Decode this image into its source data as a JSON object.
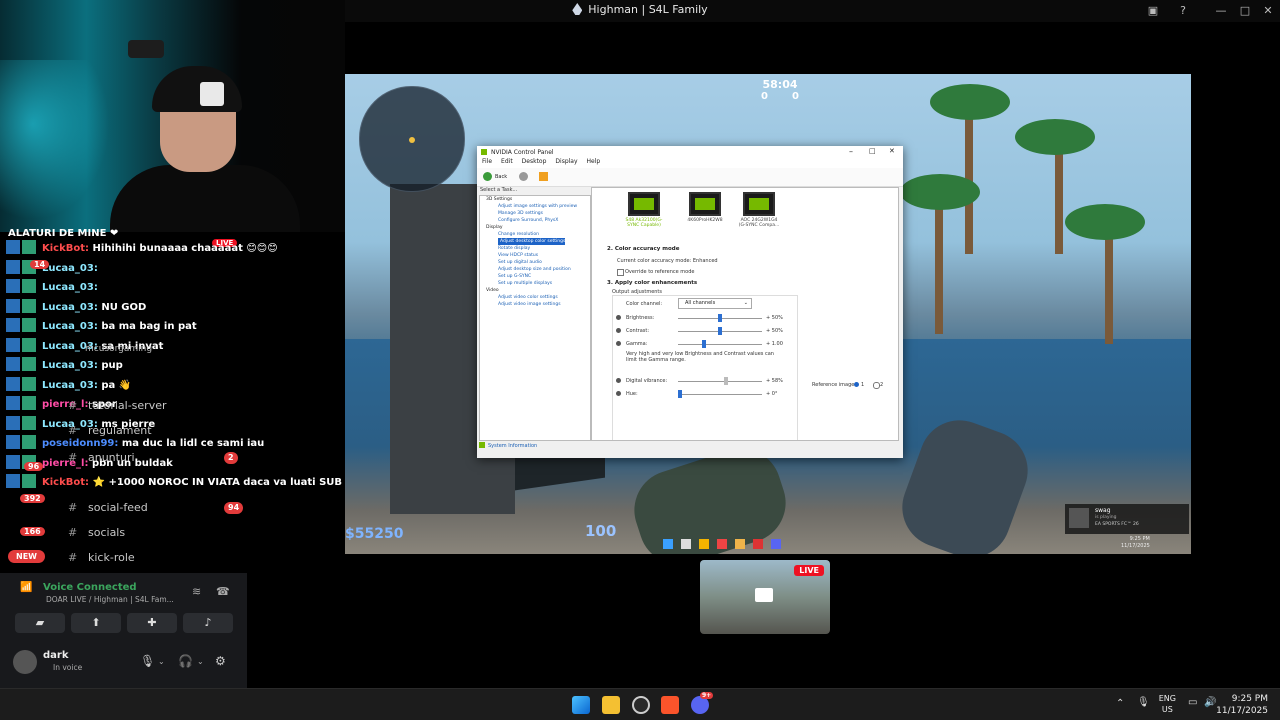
{
  "window": {
    "title": "Highman | S4L Family"
  },
  "chat": {
    "header": "ALATURI DE MINE ❤",
    "live_badge": "LIVE",
    "messages": [
      {
        "user": "KickBot:",
        "text": "Hihihihi bunaaaa chaaaaat 😊😊😊",
        "color": "#ff4d4d"
      },
      {
        "user": "Lucaa_03:",
        "text": "",
        "color": "#8ee8ff"
      },
      {
        "user": "Lucaa_03:",
        "text": "",
        "color": "#8ee8ff"
      },
      {
        "user": "Lucaa_03:",
        "text": "NU  GOD",
        "color": "#8ee8ff"
      },
      {
        "user": "Lucaa_03:",
        "text": "ba ma bag in pat",
        "color": "#8ee8ff"
      },
      {
        "user": "Lucaa_03:",
        "text": "sa mi invat",
        "color": "#8ee8ff"
      },
      {
        "user": "Lucaa_03:",
        "text": "pup",
        "color": "#8ee8ff"
      },
      {
        "user": "Lucaa_03:",
        "text": "pa 👋",
        "color": "#8ee8ff"
      },
      {
        "user": "pierre_l:",
        "text": "spor",
        "color": "#ff4da6"
      },
      {
        "user": "Lucaa_03:",
        "text": "ms pierre",
        "color": "#8ee8ff"
      },
      {
        "user": "poseidonn99:",
        "text": "ma duc la lidl ce sami iau",
        "color": "#4d8dff"
      },
      {
        "user": "pierre_l:",
        "text": "pbn un buldak",
        "color": "#ff4da6"
      },
      {
        "user": "KickBot:",
        "text": "⭐ +1000 NOROC IN VIATA daca va luati SUB",
        "color": "#ff4d4d"
      }
    ]
  },
  "discord": {
    "channels": [
      {
        "name": "tutorial-server"
      },
      {
        "name": "regulament"
      },
      {
        "name": "anunturi",
        "badge": "2"
      },
      {
        "name": "social-feed",
        "badge": "94"
      },
      {
        "name": "socials"
      },
      {
        "name": "kick-role"
      }
    ],
    "overlay_text": "mcusorgaming",
    "server_badges": [
      "14",
      "96",
      "392",
      "166"
    ],
    "new_badge": "NEW",
    "voice": {
      "status": "Voice Connected",
      "channel": "DOAR LIVE / Highman | S4L Fam..."
    },
    "user": {
      "name": "dark",
      "status": "In voice"
    }
  },
  "game": {
    "timer": "58:04",
    "score_ct": "0",
    "score_t": "0",
    "money": "$55250",
    "health": "100",
    "tray_notification": {
      "title": "swag",
      "subtitle": "is playing",
      "game": "EA SPORTS FC™ 26"
    },
    "tray_time": "9:25 PM",
    "tray_date": "11/17/2025"
  },
  "nvidia_panel": {
    "title": "NVIDIA Control Panel",
    "menu": [
      "File",
      "Edit",
      "Desktop",
      "Display",
      "Help"
    ],
    "back_label": "Back",
    "select_task": "Select a Task...",
    "tree": [
      {
        "type": "cat",
        "label": "3D Settings"
      },
      {
        "type": "item",
        "label": "Adjust image settings with preview"
      },
      {
        "type": "item",
        "label": "Manage 3D settings"
      },
      {
        "type": "item",
        "label": "Configure Surround, PhysX"
      },
      {
        "type": "cat",
        "label": "Display"
      },
      {
        "type": "item",
        "label": "Change resolution"
      },
      {
        "type": "sel",
        "label": "Adjust desktop color settings"
      },
      {
        "type": "item",
        "label": "Rotate display"
      },
      {
        "type": "item",
        "label": "View HDCP status"
      },
      {
        "type": "item",
        "label": "Set up digital audio"
      },
      {
        "type": "item",
        "label": "Adjust desktop size and position"
      },
      {
        "type": "item",
        "label": "Set up G-SYNC"
      },
      {
        "type": "item",
        "label": "Set up multiple displays"
      },
      {
        "type": "cat",
        "label": "Video"
      },
      {
        "type": "item",
        "label": "Adjust video color settings"
      },
      {
        "type": "item",
        "label": "Adjust video image settings"
      }
    ],
    "monitors": [
      {
        "label": "S48 Ak32100(G-SYNC Capable)"
      },
      {
        "label": "4K60ProHK2W8"
      },
      {
        "label": "AOC 24G2W1G4 (G-SYNC Compa..."
      }
    ],
    "section2_title": "2. Color accuracy mode",
    "current_mode": "Current color accuracy mode: Enhanced",
    "override_label": "Override to reference mode",
    "section3_title": "3. Apply color enhancements",
    "output_adjustments": "Output adjustments",
    "color_channel_label": "Color channel:",
    "color_channel_value": "All channels",
    "sliders": [
      {
        "label": "Brightness:",
        "value": "+ 50%",
        "pos": 0.5
      },
      {
        "label": "Contrast:",
        "value": "+ 50%",
        "pos": 0.5
      },
      {
        "label": "Gamma:",
        "value": "+ 1.00",
        "pos": 0.3
      }
    ],
    "warning": "Very high and very low Brightness and Contrast values can limit the Gamma range.",
    "sliders2": [
      {
        "label": "Digital vibrance:",
        "value": "+ 58%",
        "pos": 0.58
      },
      {
        "label": "Hue:",
        "value": "+ 0°",
        "pos": 0.0
      }
    ],
    "reference_image_label": "Reference image:",
    "reference_options": [
      "1",
      "2"
    ],
    "system_info": "System Information"
  },
  "preview": {
    "live_label": "LIVE"
  },
  "taskbar": {
    "language_top": "ENG",
    "language_bottom": "US",
    "time": "9:25 PM",
    "date": "11/17/2025",
    "discord_badge": "9+"
  }
}
